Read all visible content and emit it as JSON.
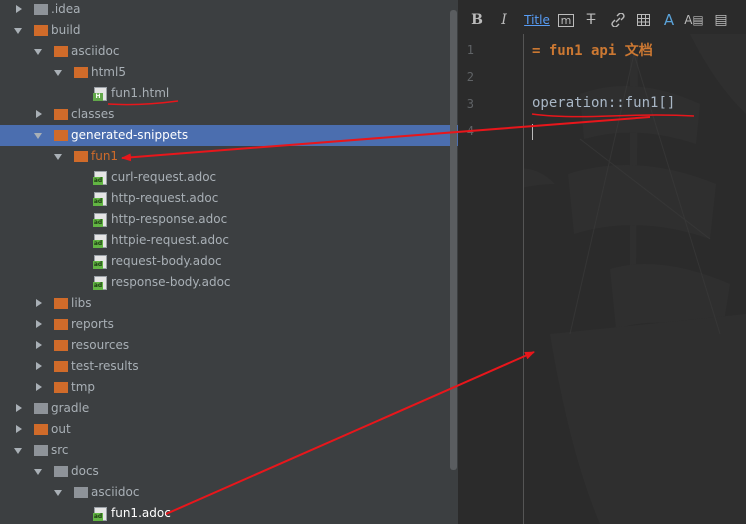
{
  "tree": {
    "items": [
      {
        "label": ".idea",
        "kind": "folder",
        "folder_color": "gray",
        "expanded": false,
        "level": 0
      },
      {
        "label": "build",
        "kind": "folder",
        "folder_color": "orange",
        "expanded": true,
        "level": 0
      },
      {
        "label": "asciidoc",
        "kind": "folder",
        "folder_color": "orange",
        "expanded": true,
        "level": 1
      },
      {
        "label": "html5",
        "kind": "folder",
        "folder_color": "orange",
        "expanded": true,
        "level": 2
      },
      {
        "label": "fun1.html",
        "kind": "file",
        "file_type": "html",
        "level": 3
      },
      {
        "label": "classes",
        "kind": "folder",
        "folder_color": "orange",
        "expanded": false,
        "level": 1
      },
      {
        "label": "generated-snippets",
        "kind": "folder",
        "folder_color": "orange",
        "expanded": true,
        "level": 1,
        "selected": true
      },
      {
        "label": "fun1",
        "kind": "folder",
        "folder_color": "orange",
        "expanded": true,
        "level": 2,
        "label_color": "orange"
      },
      {
        "label": "curl-request.adoc",
        "kind": "file",
        "file_type": "adoc",
        "level": 3
      },
      {
        "label": "http-request.adoc",
        "kind": "file",
        "file_type": "adoc",
        "level": 3
      },
      {
        "label": "http-response.adoc",
        "kind": "file",
        "file_type": "adoc",
        "level": 3
      },
      {
        "label": "httpie-request.adoc",
        "kind": "file",
        "file_type": "adoc",
        "level": 3
      },
      {
        "label": "request-body.adoc",
        "kind": "file",
        "file_type": "adoc",
        "level": 3
      },
      {
        "label": "response-body.adoc",
        "kind": "file",
        "file_type": "adoc",
        "level": 3
      },
      {
        "label": "libs",
        "kind": "folder",
        "folder_color": "orange",
        "expanded": false,
        "level": 1
      },
      {
        "label": "reports",
        "kind": "folder",
        "folder_color": "orange",
        "expanded": false,
        "level": 1
      },
      {
        "label": "resources",
        "kind": "folder",
        "folder_color": "orange",
        "expanded": false,
        "level": 1
      },
      {
        "label": "test-results",
        "kind": "folder",
        "folder_color": "orange",
        "expanded": false,
        "level": 1
      },
      {
        "label": "tmp",
        "kind": "folder",
        "folder_color": "orange",
        "expanded": false,
        "level": 1
      },
      {
        "label": "gradle",
        "kind": "folder",
        "folder_color": "gray",
        "expanded": false,
        "level": 0
      },
      {
        "label": "out",
        "kind": "folder",
        "folder_color": "orange",
        "expanded": false,
        "level": 0
      },
      {
        "label": "src",
        "kind": "folder",
        "folder_color": "gray",
        "expanded": true,
        "level": 0
      },
      {
        "label": "docs",
        "kind": "folder",
        "folder_color": "gray",
        "expanded": true,
        "level": 1
      },
      {
        "label": "asciidoc",
        "kind": "folder",
        "folder_color": "gray",
        "expanded": true,
        "level": 2
      },
      {
        "label": "fun1.adoc",
        "kind": "file",
        "file_type": "adoc",
        "level": 3,
        "label_color": "white"
      }
    ],
    "file_badges": {
      "adoc": "ad",
      "html": "H"
    }
  },
  "editor": {
    "toolbar": {
      "bold": "B",
      "italic": "I",
      "title": "Title",
      "monospace": "m",
      "strikethrough": "T",
      "link": "🔗",
      "table": "⊞",
      "image": "A",
      "code": "A▤",
      "book": "▤"
    },
    "line_numbers": [
      "1",
      "2",
      "3",
      "4"
    ],
    "lines": {
      "heading": "= fun1 api 文档",
      "operation": "operation::fun1[]"
    }
  },
  "colors": {
    "tree_background": "#3c3f41",
    "selection": "#4b6eaf",
    "folder_orange": "#d06b2a",
    "folder_gray": "#8e9399",
    "editor_background": "#2b2b2b",
    "heading_text": "#cc7832",
    "annotation_red": "#e8161b"
  }
}
